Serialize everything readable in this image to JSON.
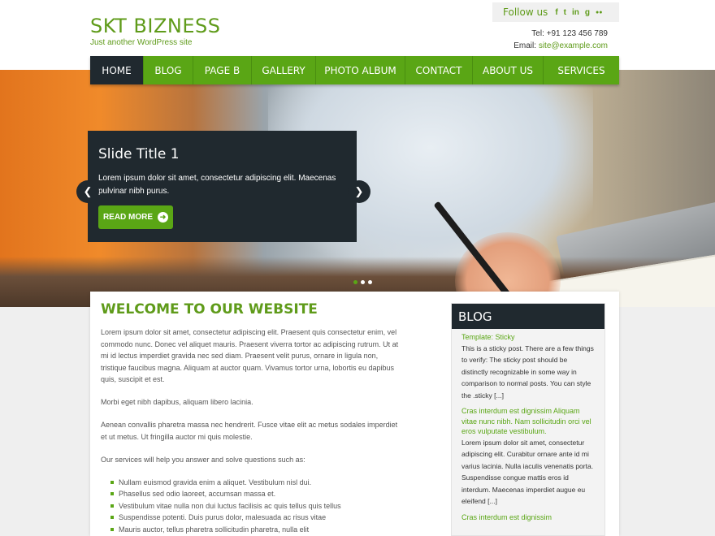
{
  "site": {
    "title": "SKT BIZNESS",
    "tagline": "Just another WordPress site"
  },
  "follow": {
    "label": "Follow us",
    "icons": [
      "f",
      "t",
      "in",
      "g",
      "●●"
    ],
    "icon_names": [
      "facebook-icon",
      "twitter-icon",
      "linkedin-icon",
      "googleplus-icon",
      "flickr-icon"
    ]
  },
  "contact": {
    "tel_label": "Tel:",
    "tel": "+91 123 456 789",
    "email_label": "Email:",
    "email": "site@example.com"
  },
  "nav": {
    "items": [
      "HOME",
      "BLOG",
      "PAGE B",
      "GALLERY",
      "PHOTO ALBUM",
      "CONTACT",
      "ABOUT US",
      "SERVICES"
    ],
    "active": 0
  },
  "slider": {
    "title": "Slide Title 1",
    "text": "Lorem ipsum dolor sit amet, consectetur adipiscing elit. Maecenas pulvinar nibh purus.",
    "button": "READ MORE",
    "prev_icon": "❮",
    "next_icon": "❯",
    "slides": 3,
    "active_slide": 0
  },
  "main": {
    "heading": "WELCOME TO OUR WEBSITE",
    "paragraphs": [
      "Lorem ipsum dolor sit amet, consectetur adipiscing elit. Praesent quis consectetur enim, vel commodo nunc. Donec vel aliquet mauris. Praesent viverra tortor ac adipiscing rutrum. Ut at mi id lectus imperdiet gravida nec sed diam. Praesent velit purus, ornare in ligula non, tristique faucibus magna. Aliquam at auctor quam. Vivamus tortor urna, lobortis eu dapibus quis, suscipit et est.",
      "Morbi eget nibh dapibus, aliquam libero lacinia.",
      "Aenean convallis pharetra massa nec hendrerit. Fusce vitae elit ac metus sodales imperdiet et ut metus. Ut fringilla auctor mi quis molestie.",
      "Our services will help you answer and solve questions such as:"
    ],
    "services": [
      "Nullam euismod gravida enim a aliquet. Vestibulum nisl dui.",
      "Phasellus sed odio laoreet, accumsan massa et.",
      "Vestibulum vitae nulla non dui luctus facilisis ac quis tellus quis tellus",
      "Suspendisse potenti. Duis purus dolor, malesuada ac risus vitae",
      "Mauris auctor, tellus pharetra sollicitudin pharetra, nulla elit"
    ]
  },
  "sidebar": {
    "title": "BLOG",
    "posts": [
      {
        "title": "Template: Sticky",
        "excerpt": "This is a sticky post. There are a few things to verify: The sticky post should be distinctly recognizable in some way in comparison to normal posts. You can style the .sticky [...]"
      },
      {
        "title": "Cras interdum est dignissim Aliquam vitae nunc nibh. Nam sollicitudin orci vel eros vulputate vestibulum.",
        "excerpt": "Lorem ipsum dolor sit amet, consectetur adipiscing elit. Curabitur ornare ante id mi varius lacinia. Nulla iaculis venenatis porta. Suspendisse congue mattis eros id interdum. Maecenas imperdiet augue eu eleifend [...]"
      },
      {
        "title": "Cras interdum est dignissim",
        "excerpt": ""
      }
    ]
  },
  "colors": {
    "accent": "#5aa615",
    "dark": "#20292f"
  }
}
